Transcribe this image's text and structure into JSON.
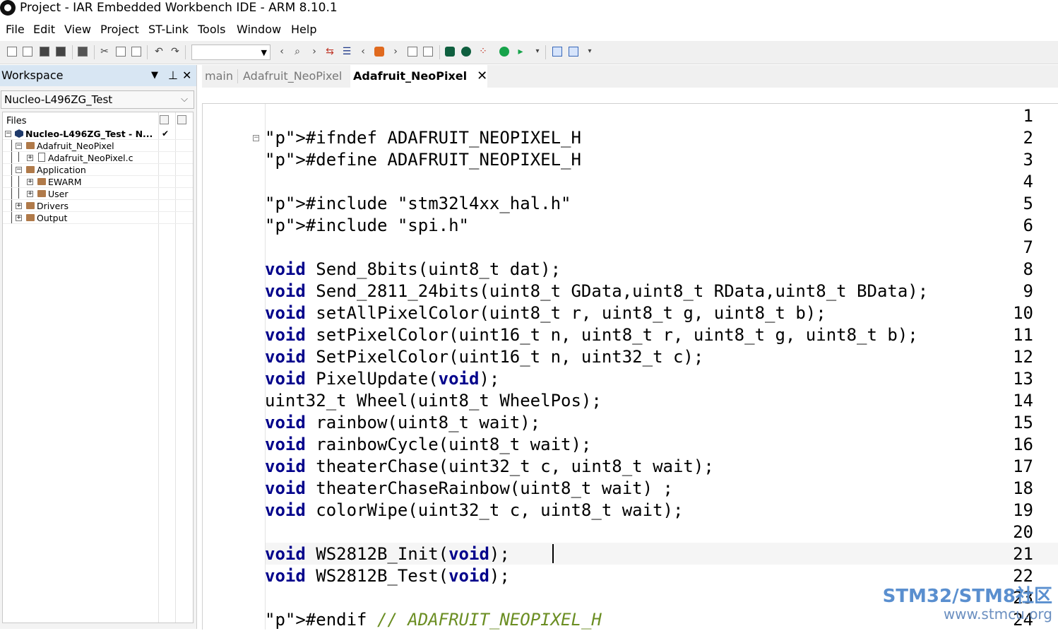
{
  "window": {
    "title": "Project - IAR Embedded Workbench IDE - ARM 8.10.1"
  },
  "menu": [
    "File",
    "Edit",
    "View",
    "Project",
    "ST-Link",
    "Tools",
    "Window",
    "Help"
  ],
  "workspace": {
    "header": "Workspace",
    "config": "Nucleo-L496ZG_Test",
    "files_label": "Files",
    "tree": [
      {
        "label": "Nucleo-L496ZG_Test - N...",
        "check": "✔"
      },
      {
        "label": "Adafruit_NeoPixel"
      },
      {
        "label": "Adafruit_NeoPixel.c"
      },
      {
        "label": "Application"
      },
      {
        "label": "EWARM"
      },
      {
        "label": "User"
      },
      {
        "label": "Drivers"
      },
      {
        "label": "Output"
      }
    ]
  },
  "tabs": [
    {
      "label": "main"
    },
    {
      "label": "Adafruit_NeoPixel"
    },
    {
      "label": "Adafruit_NeoPixel",
      "active": true
    }
  ],
  "editor": {
    "line_numbers": [
      "1",
      "2",
      "3",
      "4",
      "5",
      "6",
      "7",
      "8",
      "9",
      "10",
      "11",
      "12",
      "13",
      "14",
      "15",
      "16",
      "17",
      "18",
      "19",
      "20",
      "21",
      "22",
      "23",
      "24"
    ],
    "code_lines": [
      "",
      "#ifndef ADAFRUIT_NEOPIXEL_H",
      "#define ADAFRUIT_NEOPIXEL_H",
      "",
      "#include \"stm32l4xx_hal.h\"",
      "#include \"spi.h\"",
      "",
      "void Send_8bits(uint8_t dat);",
      "void Send_2811_24bits(uint8_t GData,uint8_t RData,uint8_t BData);",
      "void setAllPixelColor(uint8_t r, uint8_t g, uint8_t b);",
      "void setPixelColor(uint16_t n, uint8_t r, uint8_t g, uint8_t b);",
      "void SetPixelColor(uint16_t n, uint32_t c);",
      "void PixelUpdate(void);",
      "uint32_t Wheel(uint8_t WheelPos);",
      "void rainbow(uint8_t wait);",
      "void rainbowCycle(uint8_t wait);",
      "void theaterChase(uint32_t c, uint8_t wait);",
      "void theaterChaseRainbow(uint8_t wait) ;",
      "void colorWipe(uint32_t c, uint8_t wait);",
      "",
      "void WS2812B_Init(void);",
      "void WS2812B_Test(void);",
      "",
      "#endif // ADAFRUIT_NEOPIXEL_H"
    ],
    "current_line": "21"
  },
  "watermark": {
    "line1": "STM32/STM8社区",
    "line2": "www.stmcu.org"
  },
  "colors": {
    "keyword": "#00008b",
    "preprocessor": "#808000",
    "string": "#8b0000",
    "comment": "#6b8e23",
    "workspace_header": "#d8e6f3"
  }
}
